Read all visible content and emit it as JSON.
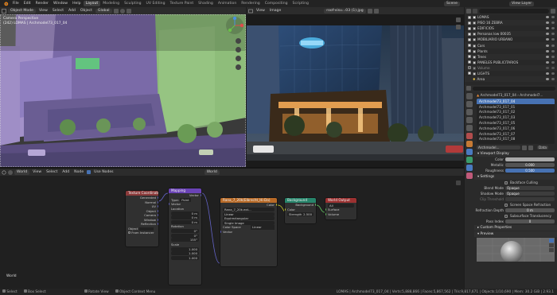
{
  "topbar": {
    "menus": [
      "File",
      "Edit",
      "Render",
      "Window",
      "Help"
    ],
    "workspaces": [
      "Layout",
      "Modeling",
      "Sculpting",
      "UV Editing",
      "Texture Paint",
      "Shading",
      "Animation",
      "Rendering",
      "Compositing",
      "Scripting"
    ],
    "active_workspace": "Layout",
    "scene_label": "Scene",
    "view_layer_label": "View Layer"
  },
  "viewport": {
    "mode": "Object Mode",
    "menus": [
      "View",
      "Select",
      "Add",
      "Object"
    ],
    "orientation": "Global",
    "camera_title": "Camera Perspective",
    "object_info": "(242) LOMAS | Archmodel73_017_04"
  },
  "image_editor": {
    "menus": [
      "View",
      "Image"
    ],
    "image_name": "roof-visu...03 (1).jpg"
  },
  "node_editor": {
    "editor_type": "World",
    "menus": [
      "View",
      "Select",
      "Add",
      "Node"
    ],
    "use_nodes_label": "Use Nodes",
    "world_name": "World",
    "corner_label": "World",
    "nodes": {
      "texcoord": {
        "title": "Texture Coordinate",
        "outputs": [
          "Generated",
          "Normal",
          "UV",
          "Object",
          "Camera",
          "Window",
          "Reflection"
        ],
        "object_label": "Object",
        "from_instancer": "From Instancer"
      },
      "mapping": {
        "title": "Mapping",
        "out": "Vector",
        "type_label": "Type:",
        "type_value": "Point",
        "vector_label": "Vector",
        "location_label": "Location",
        "location": [
          "0 m",
          "0 m",
          "0 m"
        ],
        "rotation_label": "Rotation",
        "rotation": [
          "0°",
          "0°",
          "155°"
        ],
        "scale_label": "Scale",
        "scale": [
          "1.000",
          "1.000",
          "1.000"
        ]
      },
      "envtex": {
        "title": "Rana_7_20k(Elbrecht_Hi-Da)",
        "out": "Color",
        "image": "Rana_7_20k.ext...",
        "interp": "Linear",
        "projection": "Equirectangular",
        "extension": "Single Image",
        "colorspace_label": "Color Space",
        "colorspace_value": "Linear",
        "vector": "Vector"
      },
      "background": {
        "title": "Background",
        "out": "Background",
        "color": "Color",
        "strength_label": "Strength",
        "strength_value": "2.500"
      },
      "worldout": {
        "title": "World Output",
        "target": "All",
        "inputs": [
          "Surface",
          "Volume"
        ]
      }
    }
  },
  "outliner": {
    "search_placeholder": "",
    "rows": [
      {
        "name": "LOMAS",
        "type": "collection"
      },
      {
        "name": "PISO 16 ZEBRA",
        "type": "collection"
      },
      {
        "name": "EDIFICIOS",
        "type": "collection"
      },
      {
        "name": "Personas low 00035",
        "type": "collection"
      },
      {
        "name": "MOBILIARIO URBANO",
        "type": "collection"
      },
      {
        "name": "Cars",
        "type": "collection"
      },
      {
        "name": "Plants",
        "type": "collection"
      },
      {
        "name": "Trees",
        "type": "collection"
      },
      {
        "name": "PANELES PUBLICITARIOS",
        "type": "collection"
      },
      {
        "name": "Volume",
        "type": "collection"
      },
      {
        "name": "LIGHTS",
        "type": "collection"
      },
      {
        "name": "Area",
        "type": "light"
      }
    ]
  },
  "properties": {
    "object_name": "Archmodel73_017_04",
    "material_tab_label": "Archmodel7...",
    "slots": [
      "Archmodel73_017_04",
      "Archmodel73_017_01",
      "Archmodel73_017_02",
      "Archmodel73_017_03",
      "Archmodel73_017_05",
      "Archmodel73_017_06",
      "Archmodel73_017_07",
      "Archmodel73_017_08"
    ],
    "material_selector": "Archmodel...",
    "data_label": "Data",
    "viewport_display": "Viewport Display",
    "color_label": "Color",
    "metallic_label": "Metallic",
    "metallic_value": "0.000",
    "roughness_label": "Roughness",
    "roughness_value": "0.500",
    "settings_label": "Settings",
    "backface_culling": "Backface Culling",
    "blend_mode_label": "Blend Mode",
    "blend_mode_value": "Opaque",
    "shadow_mode_label": "Shadow Mode",
    "shadow_mode_value": "Opaque",
    "clip_threshold_label": "Clip Threshold",
    "screen_space_refraction": "Screen Space Refraction",
    "refraction_depth_label": "Refraction Depth",
    "refraction_depth_value": "0 m",
    "subsurface_translucency": "Subsurface Translucency",
    "pass_index_label": "Pass Index",
    "pass_index_value": "0",
    "custom_properties": "Custom Properties",
    "preview": "Preview"
  },
  "status": {
    "items": [
      "Select",
      "Box Select",
      "Rotate View",
      "Object Context Menu"
    ],
    "stats": "LOMAS | Archmodel73_017_04 | Verts:5,888,866 | Faces:5,867,562 | Tris:9,817,671 | Objects:1/10,690 | Mem: 30.2 GiB | 2.93.1"
  },
  "colors": {
    "accent": "#4772b3",
    "header": "#2c2c2c",
    "texture_node": "#8b3a3a",
    "mapping_node": "#6a43b5",
    "image_node": "#b86a27",
    "shader_node": "#27856b",
    "output_node": "#9c3131"
  }
}
